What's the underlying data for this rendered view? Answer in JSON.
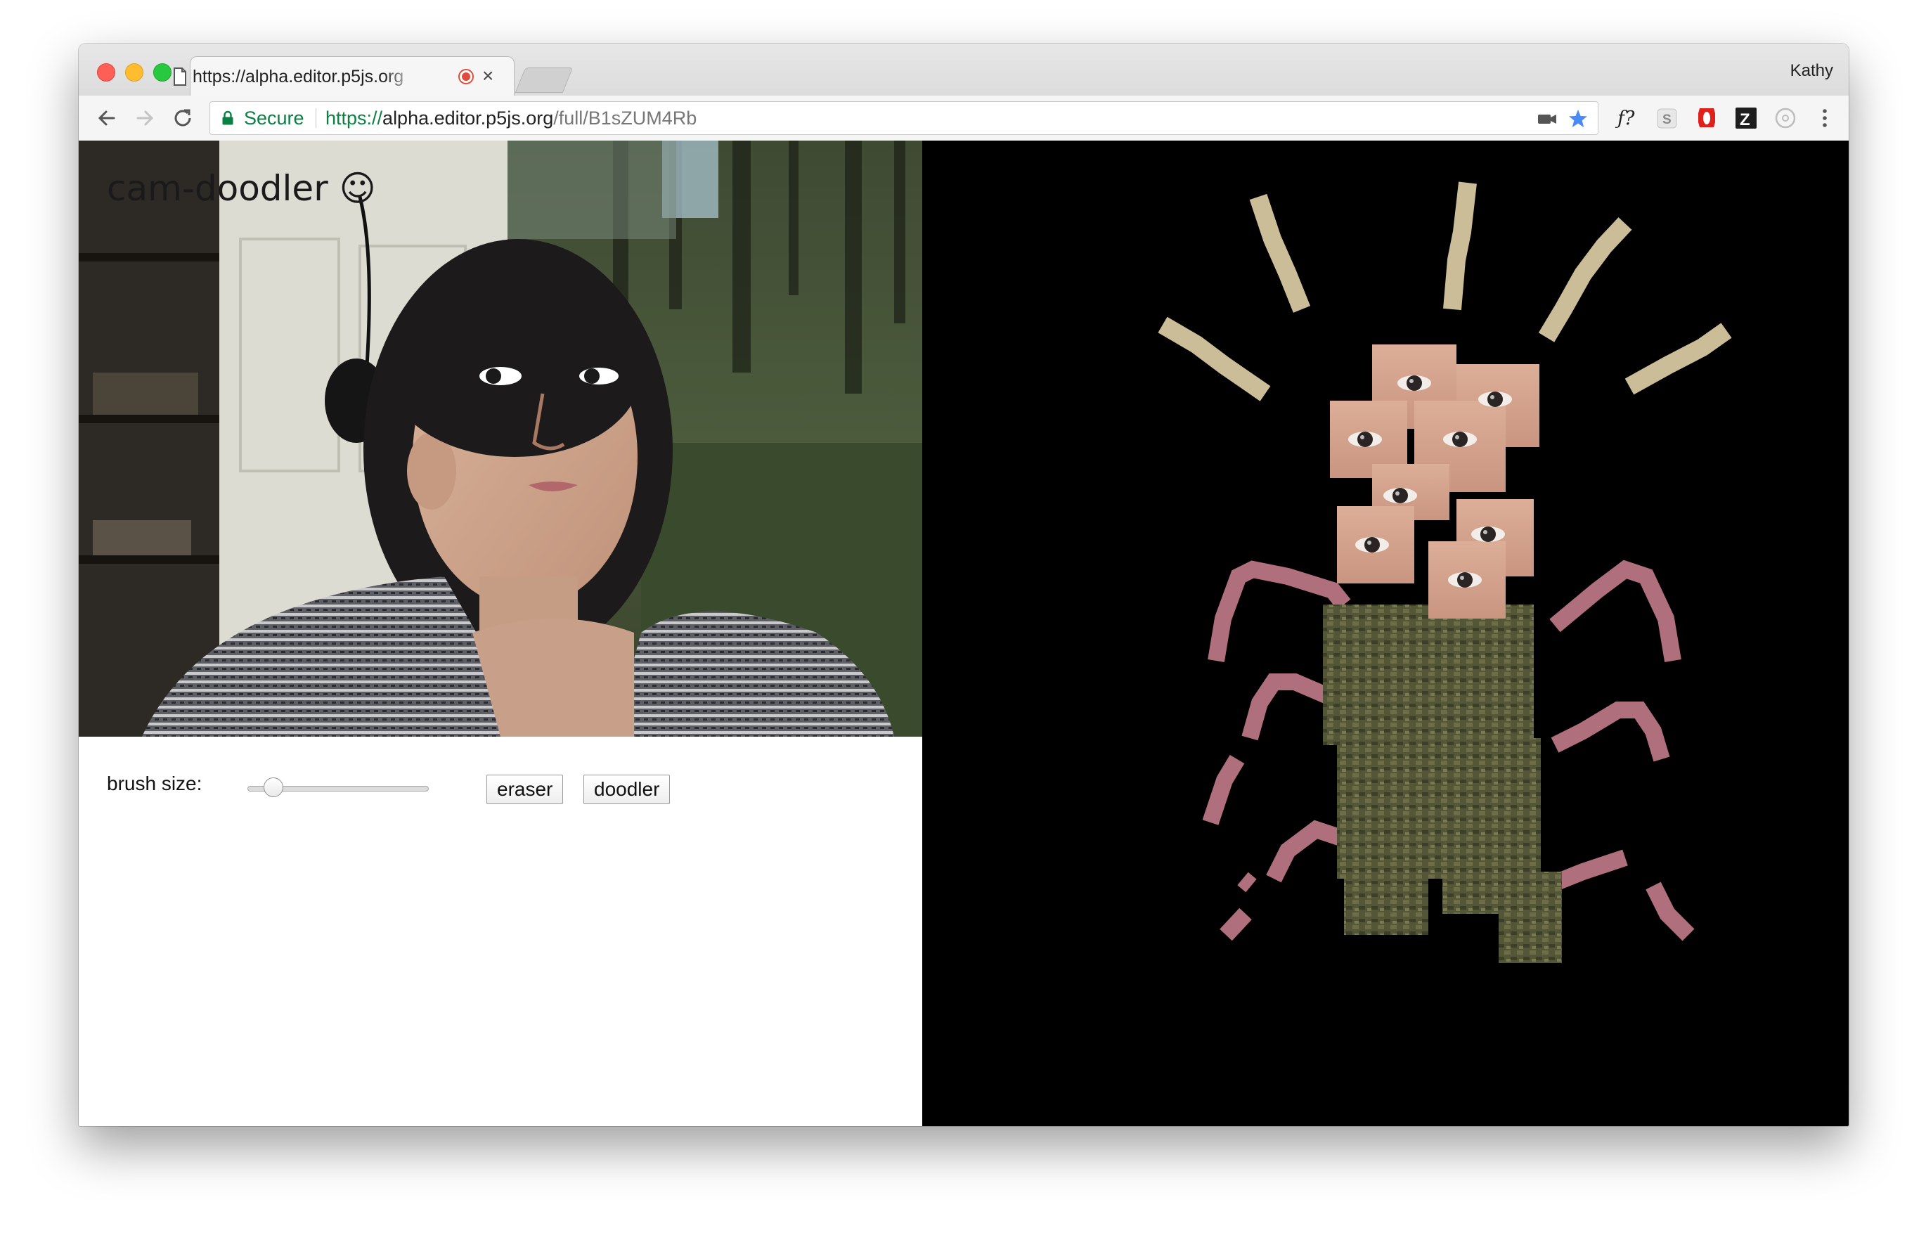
{
  "browser": {
    "tab": {
      "title": "https://alpha.editor.p5js.org",
      "close_glyph": "×"
    },
    "profile_name": "Kathy",
    "address_bar": {
      "security_label": "Secure",
      "url_scheme": "https://",
      "url_host": "alpha.editor.p5js.org",
      "url_path": "/full/B1sZUM4Rb"
    },
    "omnibox_icons": [
      "camera-icon",
      "star-bookmark-icon"
    ],
    "extension_icons": [
      "function-extension-icon",
      "s-extension-icon",
      "opera-extension-icon",
      "z-extension-icon",
      "circle-extension-icon",
      "more-menu-icon"
    ],
    "extension_text": {
      "function": "ƒ?",
      "s": "S",
      "z": "Z"
    }
  },
  "app": {
    "title": "cam-doodler",
    "title_emoji": "☺",
    "brush_label": "brush size:",
    "brush_size": 0.1,
    "buttons": {
      "eraser": "eraser",
      "doodler": "doodler"
    }
  },
  "colors": {
    "secure_green": "#0b8043",
    "canvas_bg": "#000000",
    "beige_strokes": "#cbbd98",
    "pink_strokes": "#b06f7c",
    "olive_body": "#58593d",
    "skin_patch": "#d9a891",
    "bookmark_blue": "#4a8af4"
  }
}
